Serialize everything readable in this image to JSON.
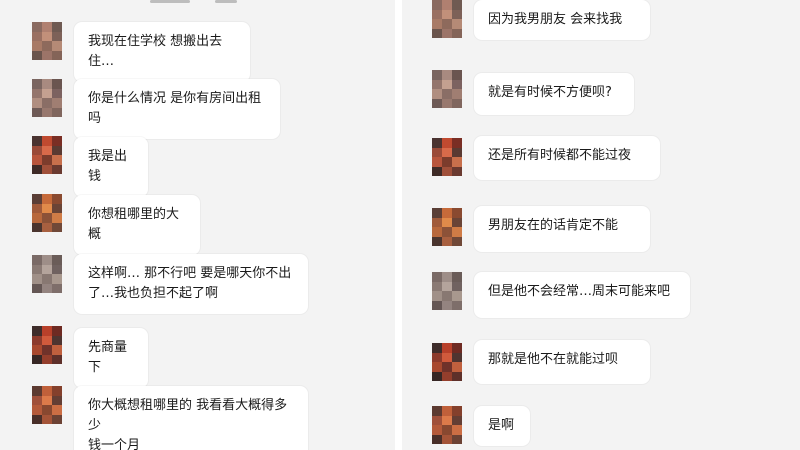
{
  "left_panel": {
    "messages": [
      {
        "text": "我现在住学校 想搬出去住…"
      },
      {
        "text": "你是什么情况 是你有房间出租吗"
      },
      {
        "text": "我是出钱"
      },
      {
        "text": "你想租哪里的大概"
      },
      {
        "text": "这样啊… 那不行吧 要是哪天你不出\n了…我也负担不起了啊"
      },
      {
        "text": "先商量下"
      },
      {
        "text": "你大概想租哪里的 我看看大概得多少\n钱一个月"
      }
    ]
  },
  "right_panel": {
    "messages": [
      {
        "text": "因为我男朋友 会来找我"
      },
      {
        "text": "就是有时候不方便呗?"
      },
      {
        "text": "还是所有时候都不能过夜"
      },
      {
        "text": "男朋友在的话肯定不能"
      },
      {
        "text": "但是他不会经常…周末可能来吧"
      },
      {
        "text": "那就是他不在就能过呗"
      },
      {
        "text": "是啊"
      }
    ]
  },
  "avatar_palettes": [
    [
      "#8a6a60",
      "#b08070",
      "#6f5a52",
      "#9a7062",
      "#c2907a",
      "#7d6158",
      "#a87a66",
      "#8e6a5c",
      "#b58a76",
      "#6a544c",
      "#9c7468",
      "#846458"
    ],
    [
      "#7a6560",
      "#a88a80",
      "#6a5550",
      "#94756c",
      "#c4a090",
      "#7c6260",
      "#b08e80",
      "#8a6e66",
      "#a07e72",
      "#6e5a56",
      "#98786e",
      "#80665e"
    ],
    [
      "#4a3330",
      "#c04a30",
      "#7a2e24",
      "#9a4a38",
      "#d86a4a",
      "#5a3a32",
      "#b8553c",
      "#7c3c2c",
      "#c8704c",
      "#3e2a26",
      "#a0503a",
      "#6a3a30"
    ],
    [
      "#5a3e36",
      "#c66a3a",
      "#8a4a30",
      "#a05a3a",
      "#e08a4a",
      "#6a4436",
      "#b8683c",
      "#8c5238",
      "#d07c46",
      "#4a342e",
      "#a86040",
      "#704838"
    ],
    [
      "#7a6a66",
      "#9e8e88",
      "#6a5c58",
      "#8a7a74",
      "#b4a49c",
      "#706260",
      "#a09088",
      "#887872",
      "#a8988e",
      "#645654",
      "#948480",
      "#7e6e6a"
    ],
    [
      "#3e2c2a",
      "#b8402a",
      "#6e2a22",
      "#8c3a2c",
      "#d05a3c",
      "#4e3430",
      "#a8482e",
      "#70322a",
      "#c0603e",
      "#362624",
      "#943e2c",
      "#5e302a"
    ],
    [
      "#5c3a30",
      "#c0603a",
      "#84402c",
      "#a0503a",
      "#dc7a4a",
      "#643e34",
      "#b45a3a",
      "#884830",
      "#cc6e44",
      "#482e28",
      "#a45438",
      "#6c4234"
    ]
  ]
}
